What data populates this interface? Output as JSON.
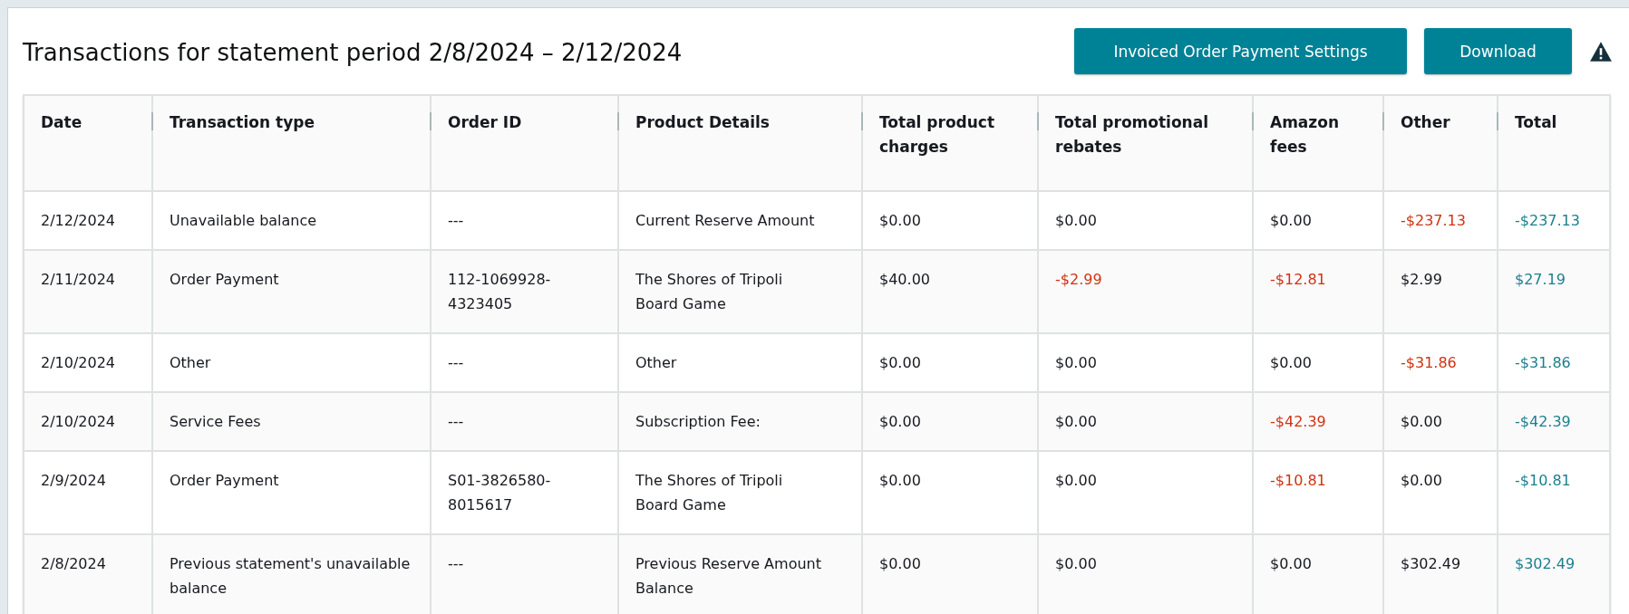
{
  "title": "Transactions for statement period 2/8/2024 – 2/12/2024",
  "buttons": [
    {
      "label": "Invoiced Order Payment Settings"
    },
    {
      "label": "Download"
    }
  ],
  "columns": [
    "Date",
    "Transaction type",
    "Order ID",
    "Product Details",
    "Total product charges",
    "Total promotional rebates",
    "Amazon fees",
    "Other",
    "Total"
  ],
  "rows": [
    {
      "date": "2/12/2024",
      "type": "Unavailable balance",
      "order_id": "---",
      "product": "Current Reserve Amount",
      "charges": "$0.00",
      "rebates": {
        "text": "$0.00",
        "negative": false
      },
      "fees": {
        "text": "$0.00",
        "negative": false
      },
      "other": {
        "text": "-$237.13",
        "negative": true
      },
      "total": "-$237.13"
    },
    {
      "date": "2/11/2024",
      "type": "Order Payment",
      "order_id": "112-1069928-4323405",
      "product": "The Shores of Tripoli Board Game",
      "charges": "$40.00",
      "rebates": {
        "text": "-$2.99",
        "negative": true
      },
      "fees": {
        "text": "-$12.81",
        "negative": true
      },
      "other": {
        "text": "$2.99",
        "negative": false
      },
      "total": "$27.19"
    },
    {
      "date": "2/10/2024",
      "type": "Other",
      "order_id": "---",
      "product": "Other",
      "charges": "$0.00",
      "rebates": {
        "text": "$0.00",
        "negative": false
      },
      "fees": {
        "text": "$0.00",
        "negative": false
      },
      "other": {
        "text": "-$31.86",
        "negative": true
      },
      "total": "-$31.86"
    },
    {
      "date": "2/10/2024",
      "type": "Service Fees",
      "order_id": "---",
      "product": "Subscription Fee:",
      "charges": "$0.00",
      "rebates": {
        "text": "$0.00",
        "negative": false
      },
      "fees": {
        "text": "-$42.39",
        "negative": true
      },
      "other": {
        "text": "$0.00",
        "negative": false
      },
      "total": "-$42.39"
    },
    {
      "date": "2/9/2024",
      "type": "Order Payment",
      "order_id": "S01-3826580-8015617",
      "product": "The Shores of Tripoli Board Game",
      "charges": "$0.00",
      "rebates": {
        "text": "$0.00",
        "negative": false
      },
      "fees": {
        "text": "-$10.81",
        "negative": true
      },
      "other": {
        "text": "$0.00",
        "negative": false
      },
      "total": "-$10.81"
    },
    {
      "date": "2/8/2024",
      "type": "Previous statement's unavailable balance",
      "order_id": "---",
      "product": "Previous Reserve Amount Balance",
      "charges": "$0.00",
      "rebates": {
        "text": "$0.00",
        "negative": false
      },
      "fees": {
        "text": "$0.00",
        "negative": false
      },
      "other": {
        "text": "$302.49",
        "negative": false
      },
      "total": "$302.49"
    }
  ]
}
